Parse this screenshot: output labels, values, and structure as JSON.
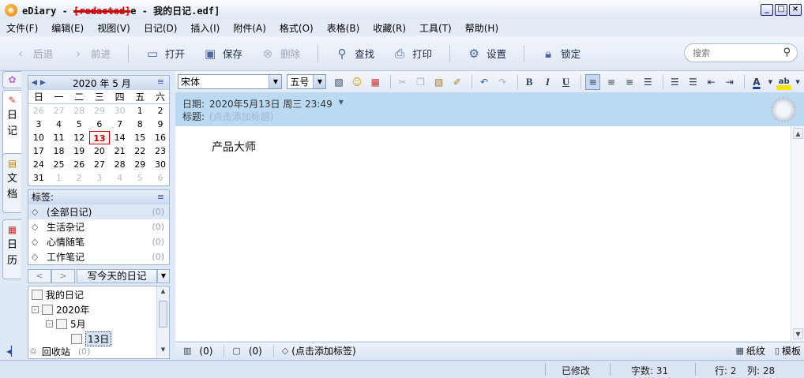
{
  "window": {
    "title_prefix": "eDiary - ",
    "title_redacted": "[redacted]",
    "title_suffix": "e - 我的日记.edf]",
    "app_icon_letter": "e",
    "buttons": [
      "_",
      "□",
      "×"
    ]
  },
  "menu": [
    "文件(F)",
    "编辑(E)",
    "视图(V)",
    "日记(D)",
    "插入(I)",
    "附件(A)",
    "格式(O)",
    "表格(B)",
    "收藏(R)",
    "工具(T)",
    "帮助(H)"
  ],
  "toolbar": {
    "back": "后退",
    "forward": "前进",
    "open": "打开",
    "save": "保存",
    "delete": "删除",
    "find": "查找",
    "print": "打印",
    "settings": "设置",
    "lock": "锁定",
    "search_placeholder": "搜索"
  },
  "vtabs": {
    "diary": [
      "日",
      "记"
    ],
    "docs": [
      "文",
      "档"
    ],
    "calendar": [
      "日",
      "历"
    ]
  },
  "calendar": {
    "year": "2020",
    "year_unit": "年",
    "month": "5",
    "month_unit": "月",
    "weekdays": [
      "日",
      "一",
      "二",
      "三",
      "四",
      "五",
      "六"
    ],
    "weeks": [
      [
        {
          "d": "26",
          "m": true
        },
        {
          "d": "27",
          "m": true
        },
        {
          "d": "28",
          "m": true
        },
        {
          "d": "29",
          "m": true
        },
        {
          "d": "30",
          "m": true
        },
        {
          "d": "1"
        },
        {
          "d": "2"
        }
      ],
      [
        {
          "d": "3"
        },
        {
          "d": "4"
        },
        {
          "d": "5"
        },
        {
          "d": "6"
        },
        {
          "d": "7"
        },
        {
          "d": "8"
        },
        {
          "d": "9"
        }
      ],
      [
        {
          "d": "10"
        },
        {
          "d": "11"
        },
        {
          "d": "12"
        },
        {
          "d": "13",
          "today": true
        },
        {
          "d": "14"
        },
        {
          "d": "15"
        },
        {
          "d": "16"
        }
      ],
      [
        {
          "d": "17"
        },
        {
          "d": "18"
        },
        {
          "d": "19"
        },
        {
          "d": "20"
        },
        {
          "d": "21"
        },
        {
          "d": "22"
        },
        {
          "d": "23"
        }
      ],
      [
        {
          "d": "24"
        },
        {
          "d": "25"
        },
        {
          "d": "26"
        },
        {
          "d": "27"
        },
        {
          "d": "28"
        },
        {
          "d": "29"
        },
        {
          "d": "30"
        }
      ],
      [
        {
          "d": "31"
        },
        {
          "d": "1",
          "m": true
        },
        {
          "d": "2",
          "m": true
        },
        {
          "d": "3",
          "m": true
        },
        {
          "d": "4",
          "m": true
        },
        {
          "d": "5",
          "m": true
        },
        {
          "d": "6",
          "m": true
        }
      ]
    ]
  },
  "tags": {
    "header": "标签:",
    "items": [
      {
        "label": "(全部日记)",
        "count": "(0)"
      },
      {
        "label": "生活杂记",
        "count": "(0)"
      },
      {
        "label": "心情随笔",
        "count": "(0)"
      },
      {
        "label": "工作笔记",
        "count": "(0)"
      }
    ]
  },
  "write_today": "写今天的日记",
  "tree": {
    "root": "我的日记",
    "year": "2020年",
    "month": "5月",
    "day": "13日"
  },
  "recycle": {
    "label": "回收站",
    "count": "(0)"
  },
  "format": {
    "font": "宋体",
    "size": "五号"
  },
  "entry": {
    "date_label": "日期:",
    "date_value": "2020年5月13日 周三 23:49",
    "title_label": "标题:",
    "title_placeholder": "(点击添加标题)",
    "body": "产品大师"
  },
  "editor_bottom": {
    "attachments": "(0)",
    "comments": "(0)",
    "add_tag": "(点击添加标签)",
    "paper": "纸纹",
    "template": "模板"
  },
  "status": {
    "modified": "已修改",
    "wordcount_label": "字数: ",
    "wordcount": "31",
    "row_label": "行: ",
    "row": "2",
    "col_label": "列: ",
    "col": "28"
  }
}
